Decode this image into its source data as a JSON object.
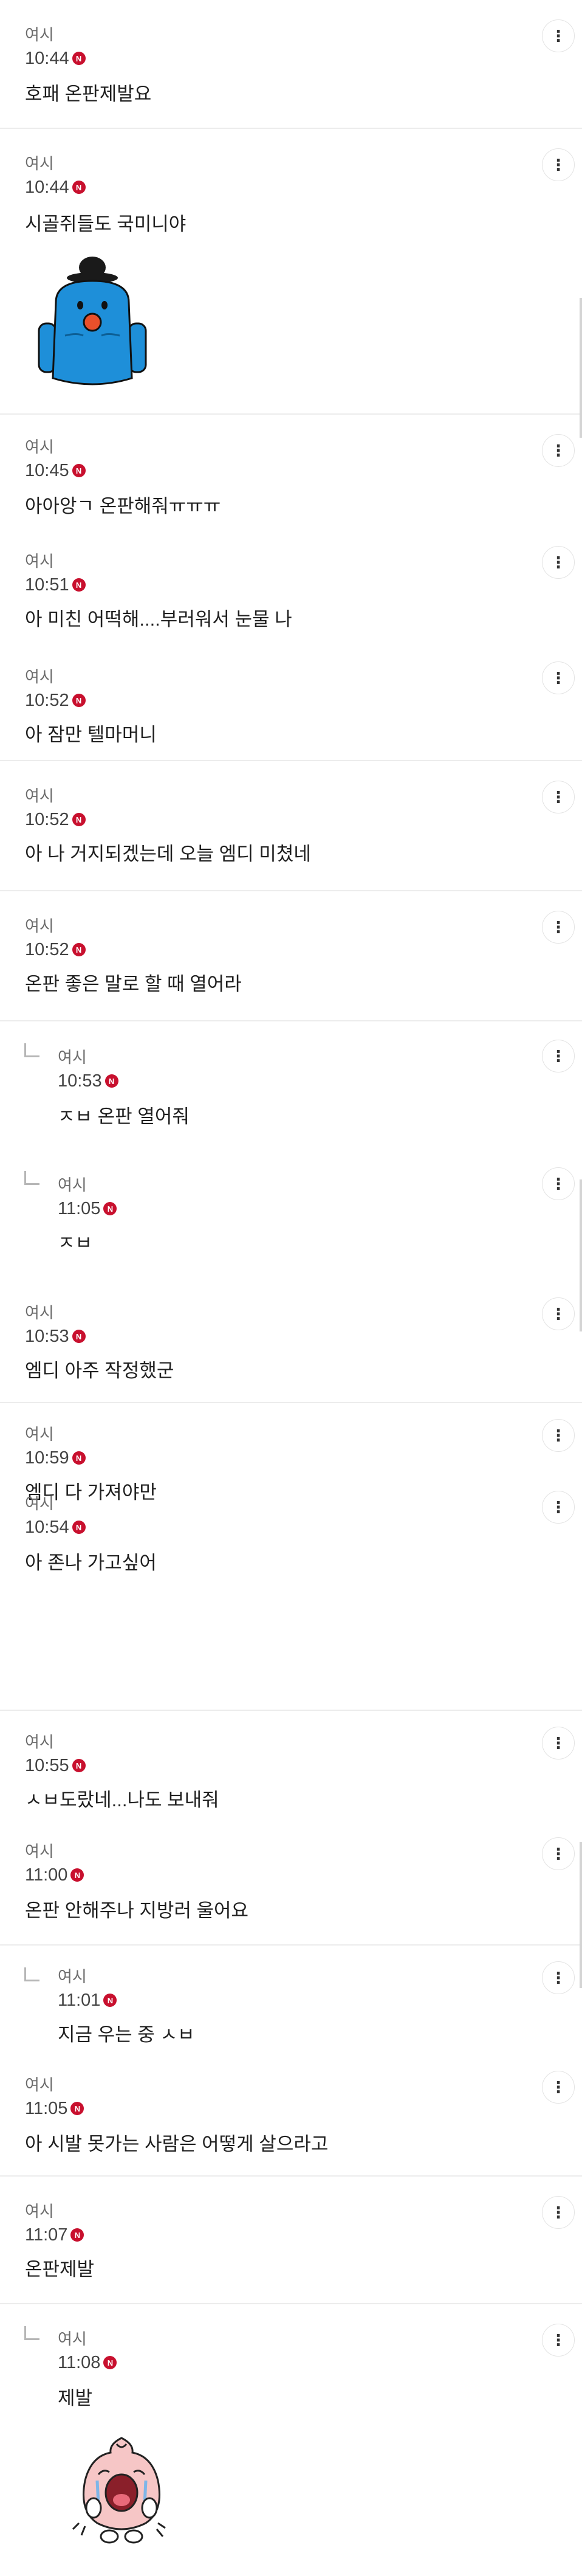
{
  "comments": [
    {
      "author": "여시",
      "time": "10:44",
      "badge": "N",
      "text": "호패 온판제발요"
    },
    {
      "author": "여시",
      "time": "10:44",
      "badge": "N",
      "text": "시골쥐들도 국미니야"
    },
    {
      "author": "여시",
      "time": "10:45",
      "badge": "N",
      "text": "아아앙ㄱ 온판해줘ㅠㅠㅠ"
    },
    {
      "author": "여시",
      "time": "10:51",
      "badge": "N",
      "text": "아 미친 어떡해....부러워서 눈물 나"
    },
    {
      "author": "여시",
      "time": "10:52",
      "badge": "N",
      "text": "아 잠만 텔마머니"
    },
    {
      "author": "여시",
      "time": "10:52",
      "badge": "N",
      "text": "아 나 거지되겠는데 오늘 엠디 미쳤네"
    },
    {
      "author": "여시",
      "time": "10:52",
      "badge": "N",
      "text": "온판 좋은 말로 할 때 열어라"
    },
    {
      "author": "여시",
      "time": "10:53",
      "badge": "N",
      "text": "ㅈㅂ 온판 열어줘"
    },
    {
      "author": "여시",
      "time": "11:05",
      "badge": "N",
      "text": "ㅈㅂ"
    },
    {
      "author": "여시",
      "time": "10:53",
      "badge": "N",
      "text": "엠디 아주 작정했군"
    },
    {
      "author": "여시",
      "time": "10:59",
      "badge": "N",
      "text": "엠디 다 가져야만"
    },
    {
      "author": "여시",
      "time": "10:54",
      "badge": "N",
      "text": "아 존나 가고싶어"
    },
    {
      "author": "여시",
      "time": "10:55",
      "badge": "N",
      "text": "ㅅㅂ도랐네...나도 보내줘"
    },
    {
      "author": "여시",
      "time": "11:00",
      "badge": "N",
      "text": "온판 안해주나 지방러 울어요"
    },
    {
      "author": "여시",
      "time": "11:01",
      "badge": "N",
      "text": "지금 우는 중 ㅅㅂ"
    },
    {
      "author": "여시",
      "time": "11:05",
      "badge": "N",
      "text": "아 시발 못가는 사람은 어떻게 살으라고"
    },
    {
      "author": "여시",
      "time": "11:07",
      "badge": "N",
      "text": "온판제발"
    },
    {
      "author": "여시",
      "time": "11:08",
      "badge": "N",
      "text": "제발"
    }
  ],
  "more_icon": "⋮",
  "stickers": [
    {
      "name": "blue-bird-sticker",
      "colors": {
        "body": "#1e8fd9",
        "hat": "#1a1a1a",
        "beak": "#e8502b"
      }
    },
    {
      "name": "crying-apeach-sticker",
      "colors": {
        "body": "#f6c6c6",
        "cheek": "#e96a7a",
        "mouth": "#8a1f2a"
      }
    }
  ]
}
